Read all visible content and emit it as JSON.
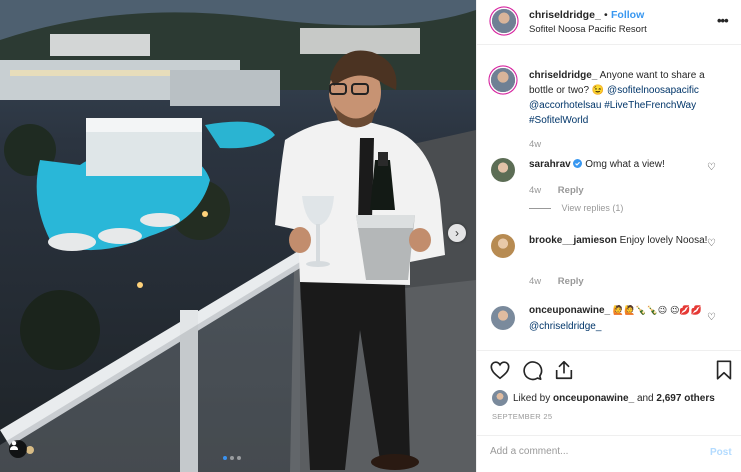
{
  "post": {
    "author": "chriseldridge_",
    "separator": "•",
    "follow_label": "Follow",
    "location": "Sofitel Noosa Pacific Resort",
    "more_icon": "ellipsis-icon"
  },
  "caption": {
    "username": "chriseldridge_",
    "text": "Anyone want to share a bottle or two? 😉",
    "mentions": [
      "@sofitelnoosapacific",
      "@accorhotelsau"
    ],
    "hashtags": [
      "#LiveTheFrenchWay",
      "#SofitelWorld"
    ],
    "age": "4w"
  },
  "comments": [
    {
      "username": "sarahrav",
      "verified": true,
      "text": "Omg what a view!",
      "age": "4w",
      "reply_label": "Reply",
      "view_replies": "View replies (1)"
    },
    {
      "username": "brooke__jamieson",
      "text": "Enjoy lovely Noosa!",
      "age": "4w",
      "reply_label": "Reply"
    },
    {
      "username": "onceuponawine_",
      "emojis": "🙋🙋🍾🍾😉 😉💋💋",
      "mention": "@chriseldridge_"
    }
  ],
  "likes": {
    "prefix": "Liked by",
    "user": "onceuponawine_",
    "connector": "and",
    "count": "2,697 others"
  },
  "date": "SEPTEMBER 25",
  "add_comment": {
    "placeholder": "Add a comment...",
    "post_label": "Post"
  },
  "carousel": {
    "slide_count": 3,
    "active_index": 0
  },
  "colors": {
    "accent": "#3897f0",
    "link": "#003569",
    "muted": "#999999",
    "verified": "#3897f0"
  },
  "icons": [
    "heart-icon",
    "comment-icon",
    "share-icon",
    "bookmark-icon",
    "tag-person-icon",
    "next-arrow-icon",
    "verified-badge-icon"
  ]
}
